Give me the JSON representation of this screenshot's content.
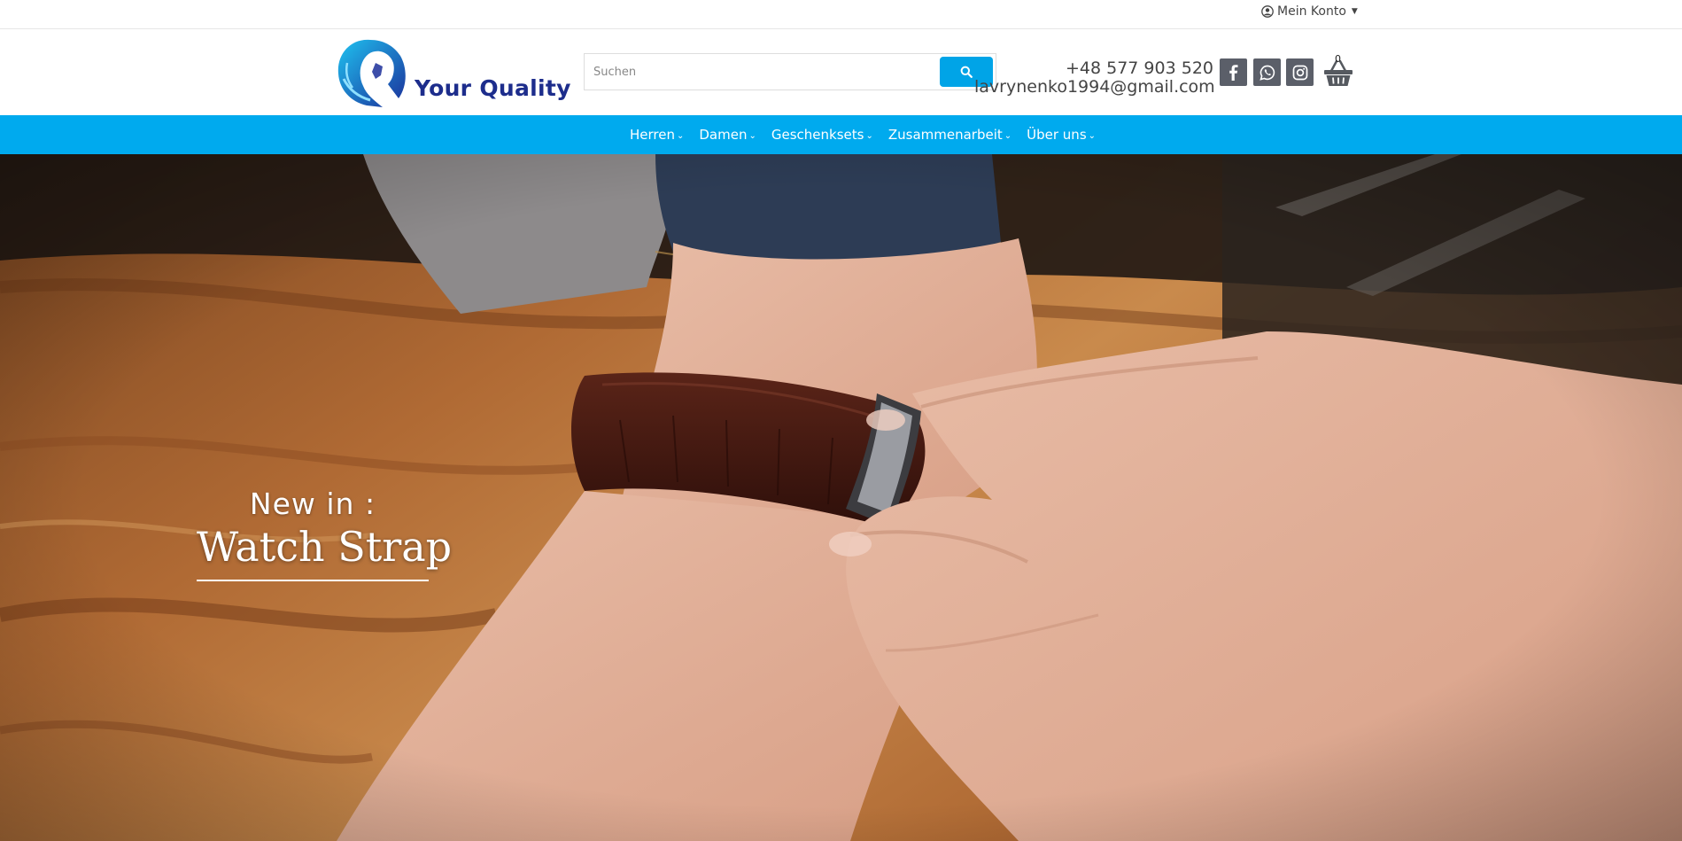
{
  "topbar": {
    "account_label": "Mein Konto"
  },
  "header": {
    "logo_text": "Your Quality",
    "search": {
      "placeholder": "Suchen",
      "value": ""
    },
    "phone": "+48 577 903 520",
    "email": "lavrynenko1994@gmail.com",
    "social_icons": [
      "facebook-icon",
      "whatsapp-icon",
      "instagram-icon"
    ],
    "cart_count": "0"
  },
  "nav": {
    "items": [
      {
        "label": "Herren"
      },
      {
        "label": "Damen"
      },
      {
        "label": "Geschenksets"
      },
      {
        "label": "Zusammenarbeit"
      },
      {
        "label": "Über uns"
      }
    ]
  },
  "hero": {
    "kicker": "New in :",
    "title": "Watch Strap"
  },
  "colors": {
    "accent": "#00aaee",
    "search_button": "#00a4e7",
    "social_bg": "#5b5f69",
    "logo_navy": "#1d2d8c"
  }
}
